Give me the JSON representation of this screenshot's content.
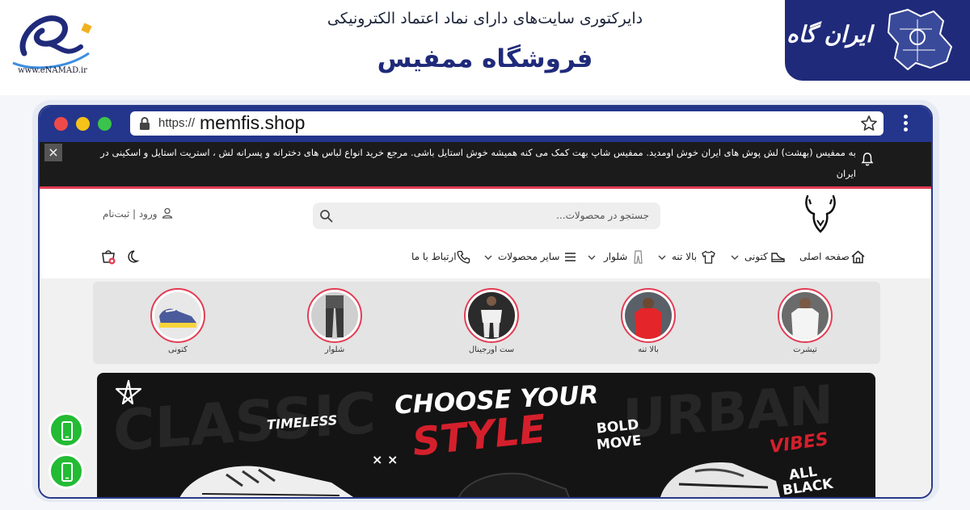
{
  "header": {
    "subtitle": "دایرکتوری سایت‌های دارای نماد اعتماد الکترونیکی",
    "title": "فروشگاه ممفیس",
    "enamad_url": "www.eNAMAD.ir",
    "brand_logo": "ایران گاه"
  },
  "browser": {
    "url_protocol": "https://",
    "url_host": "memfis.shop"
  },
  "announcement": {
    "text": "به ممفیس (بهشت) لش پوش های ایران خوش اومدید. ممفیس شاپ بهت کمک می کنه همیشه خوش استایل باشی. مرجع خرید انواع لباس های دخترانه و پسرانه لش ، استریت استایل و اسکینی در ایران"
  },
  "site": {
    "search_placeholder": "جستجو در محصولات...",
    "login_label": "ورود | ثبت‌نام",
    "nav": [
      {
        "label": "صفحه اصلی"
      },
      {
        "label": "کتونی"
      },
      {
        "label": "بالا تنه"
      },
      {
        "label": "شلوار"
      },
      {
        "label": "سایر محصولات"
      },
      {
        "label": "ارتباط با ما"
      }
    ],
    "categories": [
      {
        "label": "تیشرت",
        "color": "#f4f4f4"
      },
      {
        "label": "بالا تنه",
        "color": "#e4262b"
      },
      {
        "label": "ست اورجینال",
        "color": "#f0f0f0"
      },
      {
        "label": "شلوار",
        "color": "#3a3a3a"
      },
      {
        "label": "کتونی",
        "color": "#4a5a9a"
      }
    ]
  },
  "banner": {
    "headline_1": "CHOOSE YOUR",
    "headline_2": "STYLE",
    "timeless": "TIMELESS",
    "bold": "BOLD",
    "move": "MOVE",
    "vibes": "VIBES",
    "all": "ALL",
    "black": "BLACK",
    "bg_left": "CLASSIC",
    "bg_right": "URBAN"
  },
  "colors": {
    "accent": "#e23d55",
    "brand_blue": "#1f2a7a",
    "browser_bar": "#24358c",
    "phone_green": "#22bb33"
  }
}
